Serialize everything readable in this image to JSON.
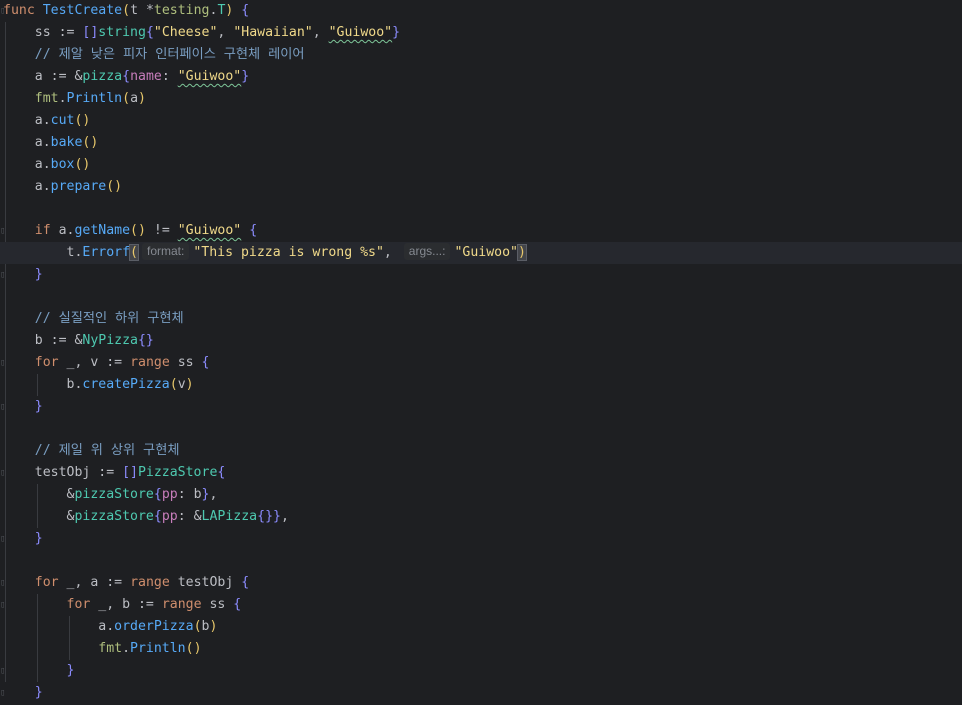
{
  "editor": {
    "lines": [
      {
        "segs": [
          [
            "kw",
            "func "
          ],
          [
            "fn",
            "TestCreate"
          ],
          [
            "paren",
            "("
          ],
          [
            "param",
            "t "
          ],
          [
            "op",
            "*"
          ],
          [
            "pkg",
            "testing"
          ],
          [
            "op",
            "."
          ],
          [
            "type",
            "T"
          ],
          [
            "paren",
            ")"
          ],
          [
            "op",
            " "
          ],
          [
            "brace",
            "{"
          ]
        ]
      },
      {
        "segs": [
          [
            "op",
            "    ss := "
          ],
          [
            "brace",
            "[]"
          ],
          [
            "type",
            "string"
          ],
          [
            "brace",
            "{"
          ],
          [
            "strd",
            "\"Cheese\""
          ],
          [
            "op",
            ", "
          ],
          [
            "strd",
            "\"Hawaiian\""
          ],
          [
            "op",
            ", "
          ],
          [
            "strd",
            "\"Guiwoo\""
          ],
          [
            "brace",
            "}"
          ]
        ]
      },
      {
        "segs": [
          [
            "cmt",
            "    // 제알 낮은 피자 인터페이스 구현체 레이어"
          ]
        ]
      },
      {
        "segs": [
          [
            "op",
            "    a := &"
          ],
          [
            "struct",
            "pizza"
          ],
          [
            "brace",
            "{"
          ],
          [
            "field",
            "name"
          ],
          [
            "op",
            ": "
          ],
          [
            "strd",
            "\"Guiwoo\""
          ],
          [
            "brace",
            "}"
          ]
        ]
      },
      {
        "segs": [
          [
            "pkg",
            "    fmt"
          ],
          [
            "op",
            "."
          ],
          [
            "meth",
            "Println"
          ],
          [
            "paren",
            "("
          ],
          [
            "op",
            "a"
          ],
          [
            "paren",
            ")"
          ]
        ]
      },
      {
        "segs": [
          [
            "op",
            "    a."
          ],
          [
            "meth",
            "cut"
          ],
          [
            "paren",
            "()"
          ]
        ]
      },
      {
        "segs": [
          [
            "op",
            "    a."
          ],
          [
            "meth",
            "bake"
          ],
          [
            "paren",
            "()"
          ]
        ]
      },
      {
        "segs": [
          [
            "op",
            "    a."
          ],
          [
            "meth",
            "box"
          ],
          [
            "paren",
            "()"
          ]
        ]
      },
      {
        "segs": [
          [
            "op",
            "    a."
          ],
          [
            "meth",
            "prepare"
          ],
          [
            "paren",
            "()"
          ]
        ]
      },
      {
        "segs": []
      },
      {
        "segs": [
          [
            "kw",
            "    if "
          ],
          [
            "op",
            "a."
          ],
          [
            "meth",
            "getName"
          ],
          [
            "paren",
            "()"
          ],
          [
            "op",
            " != "
          ],
          [
            "strd",
            "\"Guiwoo\""
          ],
          [
            "op",
            " "
          ],
          [
            "brace",
            "{"
          ]
        ]
      },
      {
        "segs": [
          [
            "op",
            "        t."
          ],
          [
            "meth",
            "Errorf"
          ],
          [
            "paren",
            "("
          ],
          [
            "hint",
            "format:"
          ],
          [
            "strd",
            "\"This pizza is wrong %s\""
          ],
          [
            "op",
            ", "
          ],
          [
            "hint",
            "args...:"
          ],
          [
            "strd",
            "\"Guiwoo\""
          ],
          [
            "paren",
            ")"
          ]
        ]
      },
      {
        "segs": [
          [
            "brace",
            "    }"
          ]
        ]
      },
      {
        "segs": []
      },
      {
        "segs": [
          [
            "cmt",
            "    // 실질적인 하위 구현체"
          ]
        ]
      },
      {
        "segs": [
          [
            "op",
            "    b := &"
          ],
          [
            "struct",
            "NyPizza"
          ],
          [
            "brace",
            "{}"
          ]
        ]
      },
      {
        "segs": [
          [
            "kw",
            "    for "
          ],
          [
            "op",
            "_, v := "
          ],
          [
            "kw",
            "range "
          ],
          [
            "op",
            "ss "
          ],
          [
            "brace",
            "{"
          ]
        ]
      },
      {
        "segs": [
          [
            "op",
            "        b."
          ],
          [
            "meth",
            "createPizza"
          ],
          [
            "paren",
            "("
          ],
          [
            "op",
            "v"
          ],
          [
            "paren",
            ")"
          ]
        ]
      },
      {
        "segs": [
          [
            "brace",
            "    }"
          ]
        ]
      },
      {
        "segs": []
      },
      {
        "segs": [
          [
            "cmt",
            "    // 제일 위 상위 구현체"
          ]
        ]
      },
      {
        "segs": [
          [
            "op",
            "    testObj := "
          ],
          [
            "brace",
            "[]"
          ],
          [
            "struct",
            "PizzaStore"
          ],
          [
            "brace",
            "{"
          ]
        ]
      },
      {
        "segs": [
          [
            "op",
            "        &"
          ],
          [
            "struct",
            "pizzaStore"
          ],
          [
            "brace",
            "{"
          ],
          [
            "field",
            "pp"
          ],
          [
            "op",
            ": b"
          ],
          [
            "brace",
            "}"
          ],
          [
            "op",
            ","
          ]
        ]
      },
      {
        "segs": [
          [
            "op",
            "        &"
          ],
          [
            "struct",
            "pizzaStore"
          ],
          [
            "brace",
            "{"
          ],
          [
            "field",
            "pp"
          ],
          [
            "op",
            ": &"
          ],
          [
            "struct",
            "LAPizza"
          ],
          [
            "brace",
            "{}}"
          ],
          [
            "op",
            ","
          ]
        ]
      },
      {
        "segs": [
          [
            "brace",
            "    }"
          ]
        ]
      },
      {
        "segs": []
      },
      {
        "segs": [
          [
            "kw",
            "    for "
          ],
          [
            "op",
            "_, a := "
          ],
          [
            "kw",
            "range "
          ],
          [
            "op",
            "testObj "
          ],
          [
            "brace",
            "{"
          ]
        ]
      },
      {
        "segs": [
          [
            "kw",
            "        for "
          ],
          [
            "op",
            "_, b := "
          ],
          [
            "kw",
            "range "
          ],
          [
            "op",
            "ss "
          ],
          [
            "brace",
            "{"
          ]
        ]
      },
      {
        "segs": [
          [
            "op",
            "            a."
          ],
          [
            "meth",
            "orderPizza"
          ],
          [
            "paren",
            "("
          ],
          [
            "op",
            "b"
          ],
          [
            "paren",
            ")"
          ]
        ]
      },
      {
        "segs": [
          [
            "pkg",
            "            fmt"
          ],
          [
            "op",
            "."
          ],
          [
            "meth",
            "Println"
          ],
          [
            "paren",
            "()"
          ]
        ]
      },
      {
        "segs": [
          [
            "brace",
            "        }"
          ]
        ]
      },
      {
        "segs": [
          [
            "brace",
            "    }"
          ]
        ]
      }
    ],
    "current_line": 11,
    "squiggly_word": "Guiwoo"
  }
}
